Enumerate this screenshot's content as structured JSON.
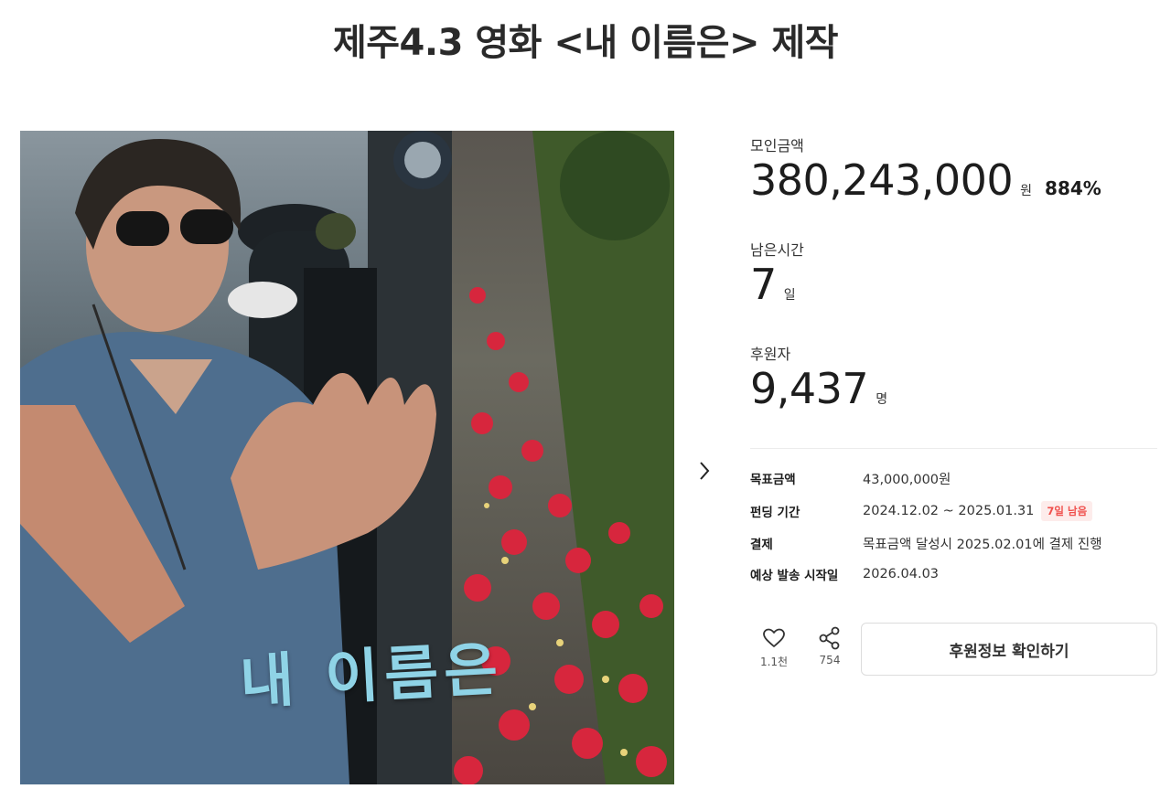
{
  "project": {
    "title": "제주4.3 영화 <내 이름은> 제작",
    "image_caption": "내 이름은"
  },
  "stats": {
    "raised_label": "모인금액",
    "raised_value": "380,243,000",
    "raised_unit": "원",
    "raised_percent": "884%",
    "remaining_label": "남은시간",
    "remaining_value": "7",
    "remaining_unit": "일",
    "backers_label": "후원자",
    "backers_value": "9,437",
    "backers_unit": "명"
  },
  "info": {
    "goal_label": "목표금액",
    "goal_value": "43,000,000원",
    "period_label": "펀딩 기간",
    "period_value": "2024.12.02 ~ 2025.01.31",
    "period_badge": "7일 남음",
    "payment_label": "결제",
    "payment_value": "목표금액 달성시 2025.02.01에 결제 진행",
    "delivery_label": "예상 발송 시작일",
    "delivery_value": "2026.04.03"
  },
  "actions": {
    "like_count": "1.1천",
    "share_count": "754",
    "cta_label": "후원정보 확인하기"
  },
  "icons": [
    "chevron-right-icon",
    "heart-icon",
    "share-icon"
  ],
  "colors": {
    "badge_text": "#f0504d",
    "badge_bg": "#fdeceb",
    "caption": "#8fd3e6"
  }
}
